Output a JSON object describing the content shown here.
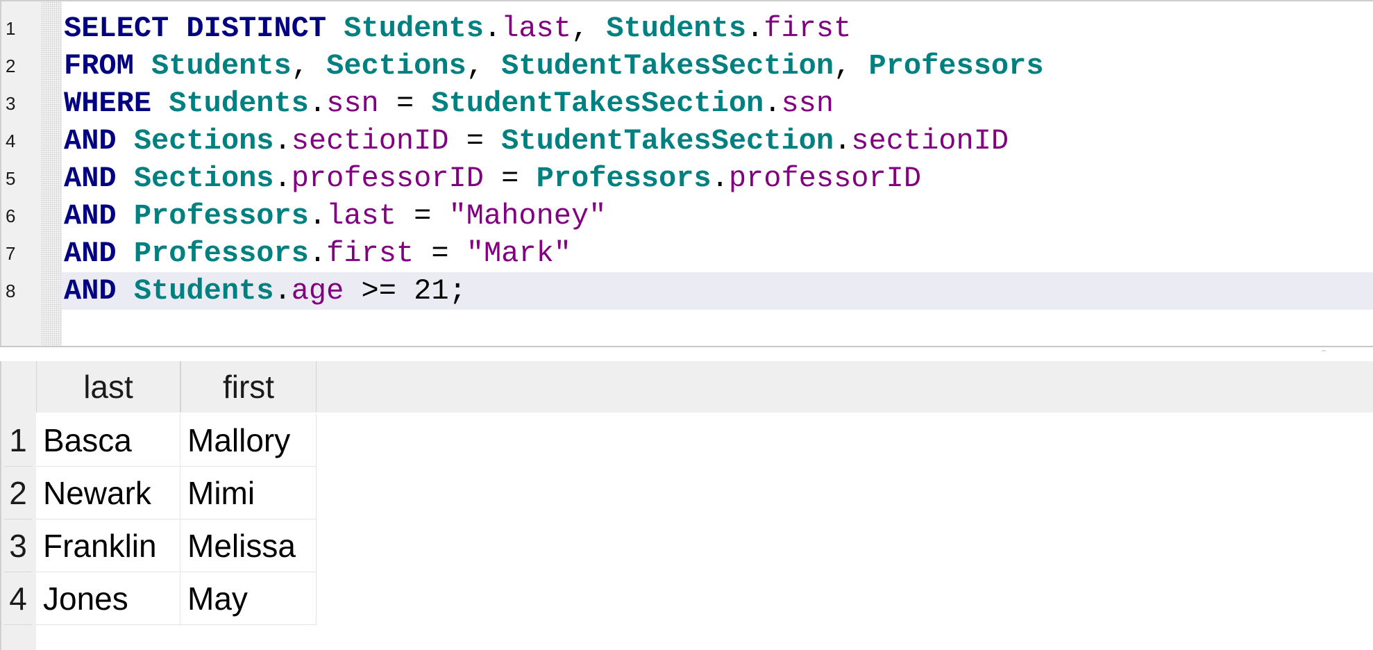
{
  "editor": {
    "lines": [
      {
        "num": "1",
        "tokens": [
          {
            "t": "SELECT DISTINCT",
            "c": "kw"
          },
          {
            "t": " ",
            "c": "op"
          },
          {
            "t": "Students",
            "c": "tbl"
          },
          {
            "t": ".",
            "c": "op"
          },
          {
            "t": "last",
            "c": "col"
          },
          {
            "t": ", ",
            "c": "op"
          },
          {
            "t": "Students",
            "c": "tbl"
          },
          {
            "t": ".",
            "c": "op"
          },
          {
            "t": "first",
            "c": "col"
          }
        ]
      },
      {
        "num": "2",
        "tokens": [
          {
            "t": "FROM",
            "c": "kw"
          },
          {
            "t": " ",
            "c": "op"
          },
          {
            "t": "Students",
            "c": "tbl"
          },
          {
            "t": ", ",
            "c": "op"
          },
          {
            "t": "Sections",
            "c": "tbl"
          },
          {
            "t": ", ",
            "c": "op"
          },
          {
            "t": "StudentTakesSection",
            "c": "tbl"
          },
          {
            "t": ", ",
            "c": "op"
          },
          {
            "t": "Professors",
            "c": "tbl"
          }
        ]
      },
      {
        "num": "3",
        "tokens": [
          {
            "t": "WHERE",
            "c": "kw"
          },
          {
            "t": " ",
            "c": "op"
          },
          {
            "t": "Students",
            "c": "tbl"
          },
          {
            "t": ".",
            "c": "op"
          },
          {
            "t": "ssn",
            "c": "col"
          },
          {
            "t": " = ",
            "c": "op"
          },
          {
            "t": "StudentTakesSection",
            "c": "tbl"
          },
          {
            "t": ".",
            "c": "op"
          },
          {
            "t": "ssn",
            "c": "col"
          }
        ]
      },
      {
        "num": "4",
        "tokens": [
          {
            "t": "AND",
            "c": "kw"
          },
          {
            "t": " ",
            "c": "op"
          },
          {
            "t": "Sections",
            "c": "tbl"
          },
          {
            "t": ".",
            "c": "op"
          },
          {
            "t": "sectionID",
            "c": "col"
          },
          {
            "t": " = ",
            "c": "op"
          },
          {
            "t": "StudentTakesSection",
            "c": "tbl"
          },
          {
            "t": ".",
            "c": "op"
          },
          {
            "t": "sectionID",
            "c": "col"
          }
        ]
      },
      {
        "num": "5",
        "tokens": [
          {
            "t": "AND",
            "c": "kw"
          },
          {
            "t": " ",
            "c": "op"
          },
          {
            "t": "Sections",
            "c": "tbl"
          },
          {
            "t": ".",
            "c": "op"
          },
          {
            "t": "professorID",
            "c": "col"
          },
          {
            "t": " = ",
            "c": "op"
          },
          {
            "t": "Professors",
            "c": "tbl"
          },
          {
            "t": ".",
            "c": "op"
          },
          {
            "t": "professorID",
            "c": "col"
          }
        ]
      },
      {
        "num": "6",
        "tokens": [
          {
            "t": "AND",
            "c": "kw"
          },
          {
            "t": " ",
            "c": "op"
          },
          {
            "t": "Professors",
            "c": "tbl"
          },
          {
            "t": ".",
            "c": "op"
          },
          {
            "t": "last",
            "c": "col"
          },
          {
            "t": " = ",
            "c": "op"
          },
          {
            "t": "\"Mahoney\"",
            "c": "str"
          }
        ]
      },
      {
        "num": "7",
        "tokens": [
          {
            "t": "AND",
            "c": "kw"
          },
          {
            "t": " ",
            "c": "op"
          },
          {
            "t": "Professors",
            "c": "tbl"
          },
          {
            "t": ".",
            "c": "op"
          },
          {
            "t": "first",
            "c": "col"
          },
          {
            "t": " = ",
            "c": "op"
          },
          {
            "t": "\"Mark\"",
            "c": "str"
          }
        ]
      },
      {
        "num": "8",
        "tokens": [
          {
            "t": "AND",
            "c": "kw"
          },
          {
            "t": " ",
            "c": "op"
          },
          {
            "t": "Students",
            "c": "tbl"
          },
          {
            "t": ".",
            "c": "op"
          },
          {
            "t": "age",
            "c": "col"
          },
          {
            "t": " >= ",
            "c": "op"
          },
          {
            "t": "21",
            "c": "num"
          },
          {
            "t": ";",
            "c": "op"
          }
        ]
      }
    ]
  },
  "results": {
    "columns": [
      "last",
      "first"
    ],
    "rows": [
      {
        "num": "1",
        "cells": [
          "Basca",
          "Mallory"
        ]
      },
      {
        "num": "2",
        "cells": [
          "Newark",
          "Mimi"
        ]
      },
      {
        "num": "3",
        "cells": [
          "Franklin",
          "Melissa"
        ]
      },
      {
        "num": "4",
        "cells": [
          "Jones",
          "May"
        ]
      }
    ]
  },
  "colors": {
    "keyword": "#000080",
    "table": "#008080",
    "column": "#800080",
    "current_line": "#ebebf3"
  }
}
